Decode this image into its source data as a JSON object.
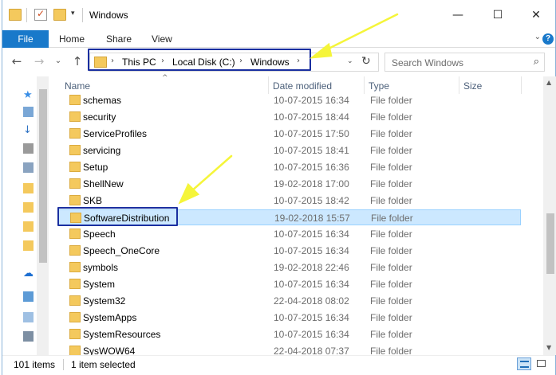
{
  "window": {
    "title": "Windows",
    "controls": {
      "minimize": "—",
      "maximize": "☐",
      "close": "✕"
    }
  },
  "ribbon": {
    "tabs": [
      "File",
      "Home",
      "Share",
      "View"
    ],
    "expand_glyph": "⌄",
    "help_glyph": "?"
  },
  "nav": {
    "back": "←",
    "forward": "→",
    "recent": "⌄",
    "up": "↑"
  },
  "address": {
    "crumbs": [
      "This PC",
      "Local Disk (C:)",
      "Windows"
    ],
    "separator": "›",
    "dropdown": "⌄",
    "refresh": "↻"
  },
  "search": {
    "placeholder": "Search Windows",
    "icon_glyph": "⌕"
  },
  "columns": {
    "name": "Name",
    "date": "Date modified",
    "type": "Type",
    "size": "Size"
  },
  "files": [
    {
      "name": "schemas",
      "date": "10-07-2015 16:34",
      "type": "File folder"
    },
    {
      "name": "security",
      "date": "10-07-2015 18:44",
      "type": "File folder"
    },
    {
      "name": "ServiceProfiles",
      "date": "10-07-2015 17:50",
      "type": "File folder"
    },
    {
      "name": "servicing",
      "date": "10-07-2015 18:41",
      "type": "File folder"
    },
    {
      "name": "Setup",
      "date": "10-07-2015 16:36",
      "type": "File folder"
    },
    {
      "name": "ShellNew",
      "date": "19-02-2018 17:00",
      "type": "File folder"
    },
    {
      "name": "SKB",
      "date": "10-07-2015 18:42",
      "type": "File folder"
    },
    {
      "name": "SoftwareDistribution",
      "date": "19-02-2018 15:57",
      "type": "File folder",
      "selected": true
    },
    {
      "name": "Speech",
      "date": "10-07-2015 16:34",
      "type": "File folder"
    },
    {
      "name": "Speech_OneCore",
      "date": "10-07-2015 16:34",
      "type": "File folder"
    },
    {
      "name": "symbols",
      "date": "19-02-2018 22:46",
      "type": "File folder"
    },
    {
      "name": "System",
      "date": "10-07-2015 16:34",
      "type": "File folder"
    },
    {
      "name": "System32",
      "date": "22-04-2018 08:02",
      "type": "File folder"
    },
    {
      "name": "SystemApps",
      "date": "10-07-2015 16:34",
      "type": "File folder"
    },
    {
      "name": "SystemResources",
      "date": "10-07-2015 16:34",
      "type": "File folder"
    },
    {
      "name": "SysWOW64",
      "date": "22-04-2018 07:37",
      "type": "File folder"
    }
  ],
  "status": {
    "item_count": "101 items",
    "selection": "1 item selected"
  },
  "colors": {
    "accent": "#1979ca",
    "selection_bg": "#cce8ff",
    "highlight_box": "#1a2fa0",
    "annotation_arrow": "#f5f53a",
    "folder": "#f4c95d"
  }
}
